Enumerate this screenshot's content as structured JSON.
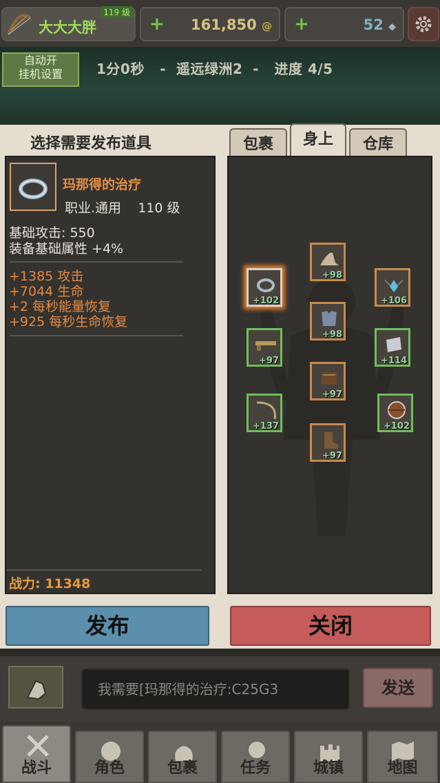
{
  "header": {
    "player_name": "大大大胖",
    "player_level": "119 级",
    "gold": "161,850",
    "gems": "52",
    "gold_icon": "coin-icon",
    "gem_icon": "gem-icon",
    "plus": "+"
  },
  "status": {
    "auto_label_line1": "自动开",
    "auto_label_line2": "挂机设置",
    "text": "1分0秒   -  遥远绿洲2  -   进度 4/5"
  },
  "left_panel": {
    "title": "选择需要发布道具",
    "item_name": "玛那得的治疗",
    "item_class": "职业.通用    110 级",
    "base_stats": [
      "基础攻击:  550",
      "装备基础属性 +4%"
    ],
    "bonus_stats": [
      "+1385 攻击",
      "+7044 生命",
      "+2 每秒能量恢复",
      "+925 每秒生命恢复"
    ],
    "power": "战力: 11348"
  },
  "tabs": [
    "包裹",
    "身上",
    "仓库"
  ],
  "active_tab": "身上",
  "equipment_slots": [
    {
      "name": "ring",
      "bonus": "+102",
      "frame": "selected"
    },
    {
      "name": "hat",
      "bonus": "+98",
      "frame": "orange"
    },
    {
      "name": "amulet",
      "bonus": "+106",
      "frame": "orange"
    },
    {
      "name": "armor",
      "bonus": "+98",
      "frame": "orange"
    },
    {
      "name": "gun",
      "bonus": "+97",
      "frame": "green"
    },
    {
      "name": "bracer",
      "bonus": "+114",
      "frame": "green"
    },
    {
      "name": "gloves",
      "bonus": "+97",
      "frame": "orange"
    },
    {
      "name": "bow",
      "bonus": "+137",
      "frame": "green"
    },
    {
      "name": "shield",
      "bonus": "+102",
      "frame": "green"
    },
    {
      "name": "boots",
      "bonus": "+97",
      "frame": "orange"
    }
  ],
  "buttons": {
    "publish": "发布",
    "close": "关闭",
    "send": "发送"
  },
  "chat": {
    "input_value": "我需要[玛那得的治疗:C25G3"
  },
  "nav": [
    "战斗",
    "角色",
    "包裹",
    "任务",
    "城镇",
    "地图"
  ],
  "colors": {
    "accent_orange": "#e48a43",
    "green_frame": "#6fbe5b",
    "publish": "#5b8fab",
    "close": "#c55b5b"
  }
}
